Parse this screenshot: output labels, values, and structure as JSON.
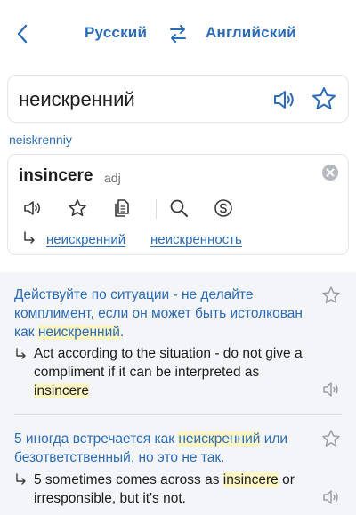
{
  "header": {
    "source_language": "Русский",
    "target_language": "Английский"
  },
  "search": {
    "query": "неискренний"
  },
  "transliteration": "neiskrenniy",
  "result": {
    "word": "insincere",
    "part_of_speech": "adj",
    "related": [
      "неискренний",
      "неискренность"
    ]
  },
  "examples": [
    {
      "source_before": "Действуйте по ситуации - не делайте комплимент, если он может быть истолкован как ",
      "source_highlight": "неискренний",
      "source_after": ".",
      "translation_before": "Act according to the situation - do not give a compliment if it can be interpreted as ",
      "translation_highlight": "insincere",
      "translation_after": ""
    },
    {
      "source_before": "5 иногда встречается как ",
      "source_highlight": "неискренний",
      "source_after": " или безответственный, но это не так.",
      "translation_before": "5 sometimes comes across as ",
      "translation_highlight": "insincere",
      "translation_after": " or irresponsible, but it's not."
    }
  ],
  "colors": {
    "accent": "#2c6bb5",
    "highlight": "#fbf6c4",
    "examples_background": "#f3f5f8"
  }
}
